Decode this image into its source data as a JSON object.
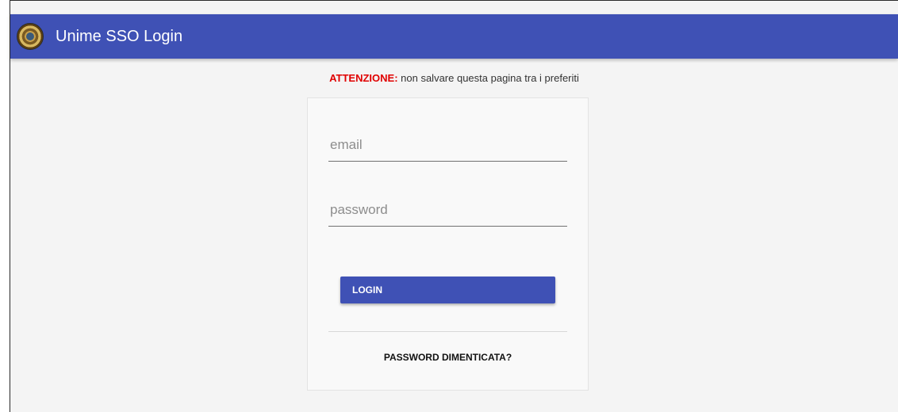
{
  "header": {
    "logo_icon": "university-seal-icon",
    "title": "Unime SSO Login",
    "color": "#3f51b5"
  },
  "notice": {
    "label": "ATTENZIONE:",
    "text": " non salvare questa pagina tra i preferiti",
    "label_color": "#e00000"
  },
  "form": {
    "email_placeholder": "email",
    "email_value": "",
    "password_placeholder": "password",
    "password_value": "",
    "login_label": "LOGIN",
    "forgot_label": "PASSWORD DIMENTICATA?"
  }
}
